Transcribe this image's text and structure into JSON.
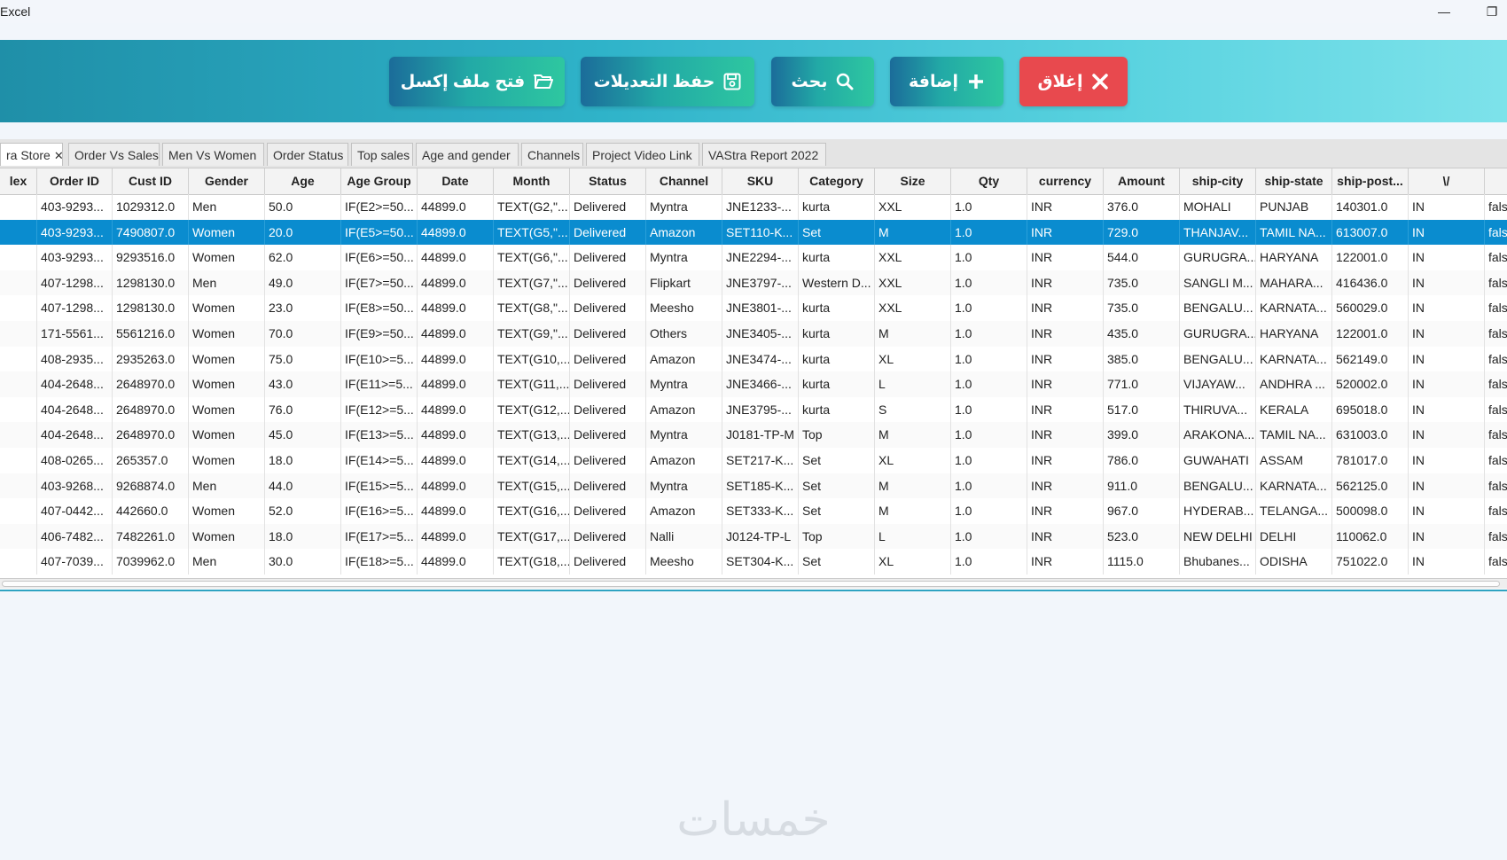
{
  "window": {
    "title": "Excel",
    "minimize": "—",
    "restore": "❐"
  },
  "toolbar": {
    "open_label": "فتح ملف إكسل",
    "save_label": "حفظ التعديلات",
    "search_label": "بحث",
    "add_label": "إضافة",
    "close_label": "إغلاق"
  },
  "tabs": [
    {
      "label": "ra Store",
      "active": true,
      "closable": true
    },
    {
      "label": "Order Vs Sales"
    },
    {
      "label": "Men Vs Women"
    },
    {
      "label": "Order Status"
    },
    {
      "label": "Top sales"
    },
    {
      "label": "Age and gender"
    },
    {
      "label": "Channels"
    },
    {
      "label": "Project Video Link"
    },
    {
      "label": "VAStra Report 2022"
    }
  ],
  "table": {
    "columns": [
      "lex",
      "Order ID",
      "Cust ID",
      "Gender",
      "Age",
      "Age Group",
      "Date",
      "Month",
      "Status",
      "Channel",
      "SKU",
      "Category",
      "Size",
      "Qty",
      "currency",
      "Amount",
      "ship-city",
      "ship-state",
      "ship-post...",
      "\\/",
      ""
    ],
    "selected_row": 1,
    "rows": [
      [
        "",
        "403-9293...",
        "1029312.0",
        "Men",
        "50.0",
        "IF(E2>=50...",
        "44899.0",
        "TEXT(G2,\"...",
        "Delivered",
        "Myntra",
        "JNE1233-...",
        "kurta",
        "XXL",
        "1.0",
        "INR",
        "376.0",
        "MOHALI",
        "PUNJAB",
        "140301.0",
        "IN",
        "fals"
      ],
      [
        "",
        "403-9293...",
        "7490807.0",
        "Women",
        "20.0",
        "IF(E5>=50...",
        "44899.0",
        "TEXT(G5,\"...",
        "Delivered",
        "Amazon",
        "SET110-K...",
        "Set",
        "M",
        "1.0",
        "INR",
        "729.0",
        "THANJAV...",
        "TAMIL NA...",
        "613007.0",
        "IN",
        "fals"
      ],
      [
        "",
        "403-9293...",
        "9293516.0",
        "Women",
        "62.0",
        "IF(E6>=50...",
        "44899.0",
        "TEXT(G6,\"...",
        "Delivered",
        "Myntra",
        "JNE2294-...",
        "kurta",
        "XXL",
        "1.0",
        "INR",
        "544.0",
        "GURUGRA...",
        "HARYANA",
        "122001.0",
        "IN",
        "fals"
      ],
      [
        "",
        "407-1298...",
        "1298130.0",
        "Men",
        "49.0",
        "IF(E7>=50...",
        "44899.0",
        "TEXT(G7,\"...",
        "Delivered",
        "Flipkart",
        "JNE3797-...",
        "Western D...",
        "XXL",
        "1.0",
        "INR",
        "735.0",
        "SANGLI M...",
        "MAHARA...",
        "416436.0",
        "IN",
        "fals"
      ],
      [
        "",
        "407-1298...",
        "1298130.0",
        "Women",
        "23.0",
        "IF(E8>=50...",
        "44899.0",
        "TEXT(G8,\"...",
        "Delivered",
        "Meesho",
        "JNE3801-...",
        "kurta",
        "XXL",
        "1.0",
        "INR",
        "735.0",
        "BENGALU...",
        "KARNATA...",
        "560029.0",
        "IN",
        "fals"
      ],
      [
        "",
        "171-5561...",
        "5561216.0",
        "Women",
        "70.0",
        "IF(E9>=50...",
        "44899.0",
        "TEXT(G9,\"...",
        "Delivered",
        "Others",
        "JNE3405-...",
        "kurta",
        "M",
        "1.0",
        "INR",
        "435.0",
        "GURUGRA...",
        "HARYANA",
        "122001.0",
        "IN",
        "fals"
      ],
      [
        "",
        "408-2935...",
        "2935263.0",
        "Women",
        "75.0",
        "IF(E10>=5...",
        "44899.0",
        "TEXT(G10,...",
        "Delivered",
        "Amazon",
        "JNE3474-...",
        "kurta",
        "XL",
        "1.0",
        "INR",
        "385.0",
        "BENGALU...",
        "KARNATA...",
        "562149.0",
        "IN",
        "fals"
      ],
      [
        "",
        "404-2648...",
        "2648970.0",
        "Women",
        "43.0",
        "IF(E11>=5...",
        "44899.0",
        "TEXT(G11,...",
        "Delivered",
        "Myntra",
        "JNE3466-...",
        "kurta",
        "L",
        "1.0",
        "INR",
        "771.0",
        "VIJAYAW...",
        "ANDHRA ...",
        "520002.0",
        "IN",
        "fals"
      ],
      [
        "",
        "404-2648...",
        "2648970.0",
        "Women",
        "76.0",
        "IF(E12>=5...",
        "44899.0",
        "TEXT(G12,...",
        "Delivered",
        "Amazon",
        "JNE3795-...",
        "kurta",
        "S",
        "1.0",
        "INR",
        "517.0",
        "THIRUVA...",
        "KERALA",
        "695018.0",
        "IN",
        "fals"
      ],
      [
        "",
        "404-2648...",
        "2648970.0",
        "Women",
        "45.0",
        "IF(E13>=5...",
        "44899.0",
        "TEXT(G13,...",
        "Delivered",
        "Myntra",
        "J0181-TP-M",
        "Top",
        "M",
        "1.0",
        "INR",
        "399.0",
        "ARAKONA...",
        "TAMIL NA...",
        "631003.0",
        "IN",
        "fals"
      ],
      [
        "",
        "408-0265...",
        "265357.0",
        "Women",
        "18.0",
        "IF(E14>=5...",
        "44899.0",
        "TEXT(G14,...",
        "Delivered",
        "Amazon",
        "SET217-K...",
        "Set",
        "XL",
        "1.0",
        "INR",
        "786.0",
        "GUWAHATI",
        "ASSAM",
        "781017.0",
        "IN",
        "fals"
      ],
      [
        "",
        "403-9268...",
        "9268874.0",
        "Men",
        "44.0",
        "IF(E15>=5...",
        "44899.0",
        "TEXT(G15,...",
        "Delivered",
        "Myntra",
        "SET185-K...",
        "Set",
        "M",
        "1.0",
        "INR",
        "911.0",
        "BENGALU...",
        "KARNATA...",
        "562125.0",
        "IN",
        "fals"
      ],
      [
        "",
        "407-0442...",
        "442660.0",
        "Women",
        "52.0",
        "IF(E16>=5...",
        "44899.0",
        "TEXT(G16,...",
        "Delivered",
        "Amazon",
        "SET333-K...",
        "Set",
        "M",
        "1.0",
        "INR",
        "967.0",
        "HYDERAB...",
        "TELANGA...",
        "500098.0",
        "IN",
        "fals"
      ],
      [
        "",
        "406-7482...",
        "7482261.0",
        "Women",
        "18.0",
        "IF(E17>=5...",
        "44899.0",
        "TEXT(G17,...",
        "Delivered",
        "Nalli",
        "J0124-TP-L",
        "Top",
        "L",
        "1.0",
        "INR",
        "523.0",
        "NEW DELHI",
        "DELHI",
        "110062.0",
        "IN",
        "fals"
      ],
      [
        "",
        "407-7039...",
        "7039962.0",
        "Men",
        "30.0",
        "IF(E18>=5...",
        "44899.0",
        "TEXT(G18,...",
        "Delivered",
        "Meesho",
        "SET304-K...",
        "Set",
        "XL",
        "1.0",
        "INR",
        "1115.0",
        "Bhubanes...",
        "ODISHA",
        "751022.0",
        "IN",
        "fals"
      ]
    ]
  },
  "watermark": "خمسات",
  "colors": {
    "accent": "#0a8ccf",
    "toolbar_start": "#1f8fa8",
    "toolbar_end": "#7de2ea",
    "close_red": "#e8494e"
  }
}
